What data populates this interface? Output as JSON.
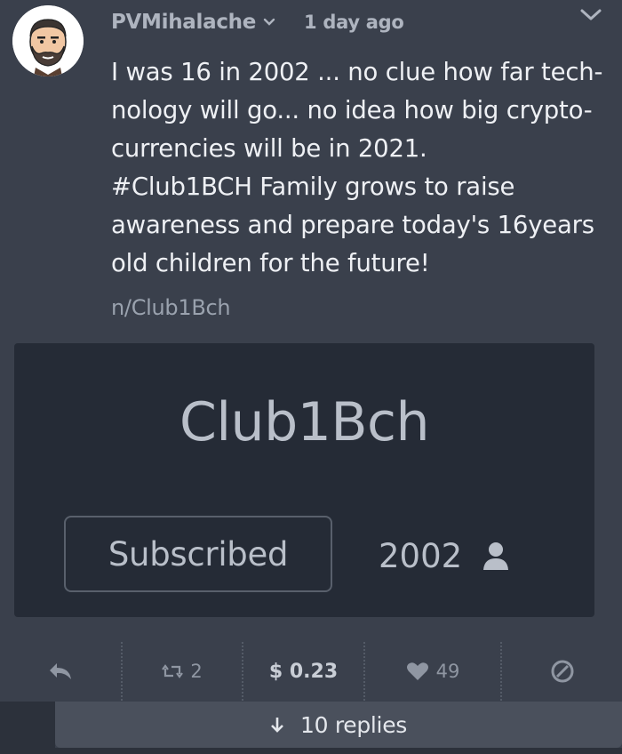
{
  "post": {
    "username": "PVMihalache",
    "time": "1 day ago",
    "lines": [
      "I was 16 in 2002 ... no clue how far tech-",
      "nology will go... no idea how big crypto-",
      "currencies will be in 2021.",
      "#Club1BCH Family grows to raise",
      "awareness and prepare today's 16years",
      "old children for the future!"
    ],
    "community_link": "n/Club1Bch"
  },
  "card": {
    "title": "Club1Bch",
    "subscribe_label": "Subscribed",
    "member_count": "2002"
  },
  "actions": {
    "retweets": "2",
    "tip": "$ 0.23",
    "likes": "49"
  },
  "replies": {
    "label": "10 replies"
  },
  "colors": {
    "background": "#3a404c",
    "card": "#252b36",
    "muted_text": "#aeb4bf",
    "replies_bar": "#4a505c"
  },
  "icons": [
    "avatar-face",
    "chevron-down-icon",
    "reply-icon",
    "repost-icon",
    "heart-icon",
    "block-icon",
    "user-icon",
    "arrow-down-icon"
  ]
}
